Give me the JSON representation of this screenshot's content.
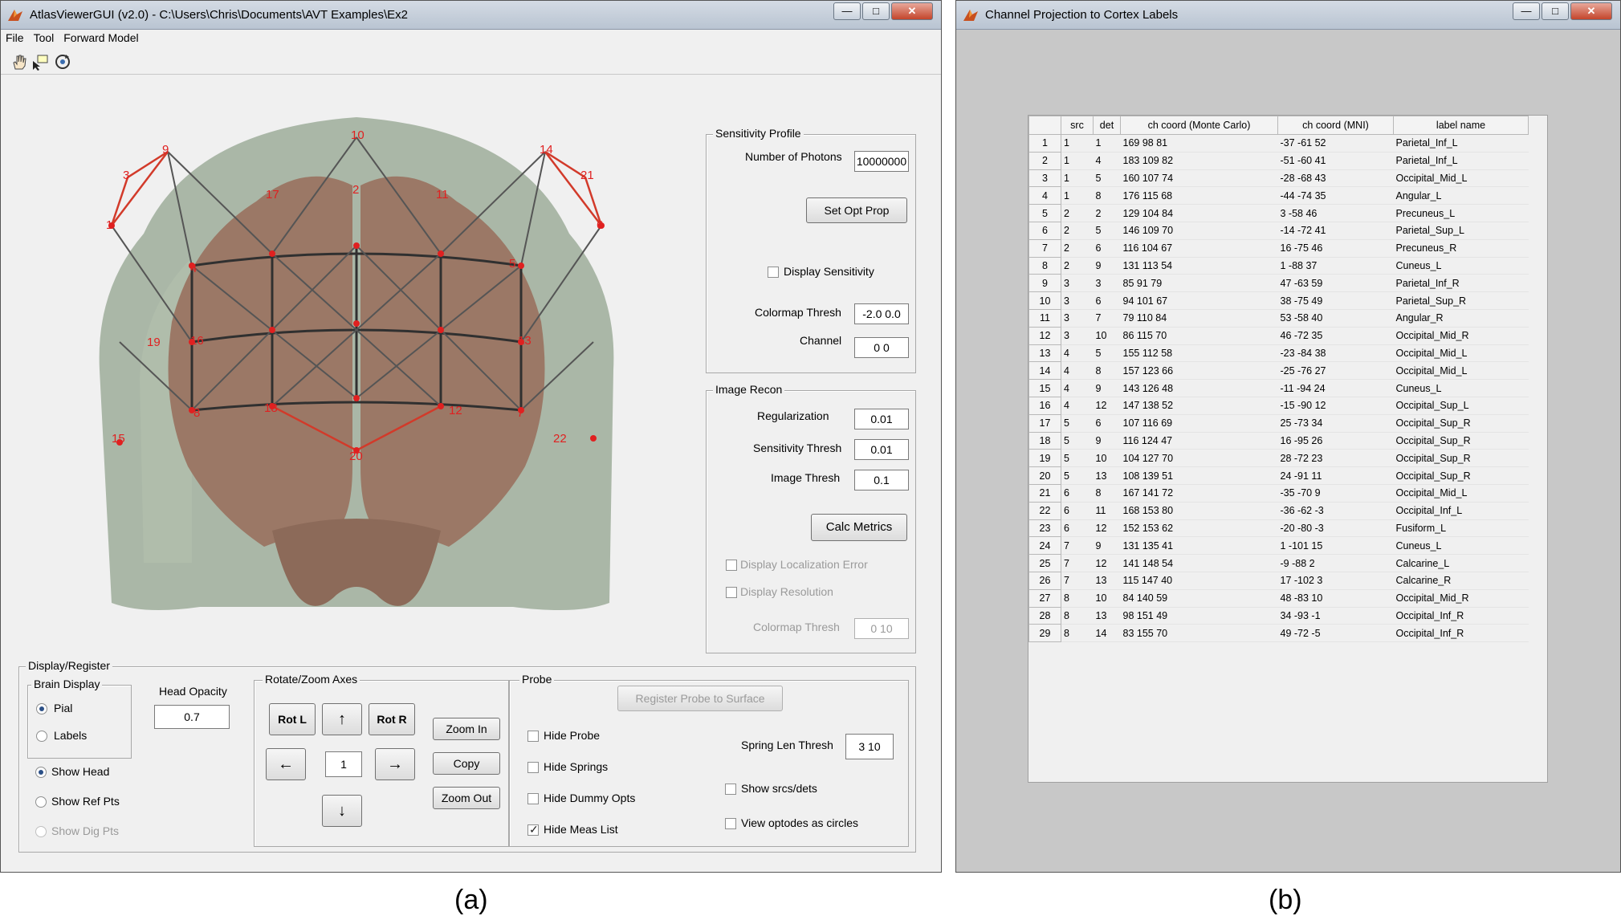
{
  "window_a": {
    "title": "AtlasViewerGUI  (v2.0) - C:\\Users\\Chris\\Documents\\AVT Examples\\Ex2",
    "menu": [
      "File",
      "Tool",
      "Forward Model"
    ],
    "sensitivity_profile": {
      "title": "Sensitivity Profile",
      "num_photons_label": "Number of Photons",
      "num_photons_value": "10000000",
      "set_opt_prop": "Set Opt Prop",
      "display_sensitivity": "Display Sensitivity",
      "colormap_thresh_label": "Colormap Thresh",
      "colormap_thresh_value": "-2.0 0.0",
      "channel_label": "Channel",
      "channel_value": "0 0"
    },
    "image_recon": {
      "title": "Image Recon",
      "regularization_label": "Regularization",
      "regularization_value": "0.01",
      "sens_thresh_label": "Sensitivity Thresh",
      "sens_thresh_value": "0.01",
      "image_thresh_label": "Image Thresh",
      "image_thresh_value": "0.1",
      "calc_metrics": "Calc Metrics",
      "display_loc_error": "Display Localization Error",
      "display_resolution": "Display Resolution",
      "colormap_thresh_label": "Colormap Thresh",
      "colormap_thresh_value": "0 10"
    },
    "display_register": {
      "title": "Display/Register",
      "brain_display": "Brain Display",
      "pial": "Pial",
      "labels": "Labels",
      "head_opacity_label": "Head Opacity",
      "head_opacity_value": "0.7",
      "show_head": "Show Head",
      "show_ref_pts": "Show Ref Pts",
      "show_dig_pts": "Show Dig Pts"
    },
    "rotate_zoom": {
      "title": "Rotate/Zoom Axes",
      "rot_l": "Rot L",
      "up": "↑",
      "rot_r": "Rot R",
      "left": "←",
      "step": "1",
      "right": "→",
      "down": "↓",
      "zoom_in": "Zoom In",
      "copy": "Copy",
      "zoom_out": "Zoom Out"
    },
    "probe": {
      "title": "Probe",
      "register": "Register Probe to Surface",
      "hide_probe": "Hide Probe",
      "hide_springs": "Hide Springs",
      "hide_dummy": "Hide Dummy Opts",
      "hide_meas": "Hide Meas List",
      "spring_len_label": "Spring Len Thresh",
      "spring_len_value": "3  10",
      "show_srcs": "Show srcs/dets",
      "view_circles": "View optodes as circles"
    },
    "optode_labels": [
      "10",
      "9",
      "3",
      "1",
      "14",
      "21",
      "6",
      "17",
      "2",
      "11",
      "19",
      "5",
      "4",
      "15",
      "8",
      "7",
      "18",
      "20",
      "12",
      "16",
      "13",
      "22"
    ]
  },
  "window_b": {
    "title": "Channel Projection to Cortex Labels",
    "columns": [
      "src",
      "det",
      "ch coord (Monte Carlo)",
      "ch coord (MNI)",
      "label name"
    ],
    "rows": [
      [
        "1",
        "1",
        "169  98  81",
        "-37 -61  52",
        "Parietal_Inf_L"
      ],
      [
        "1",
        "4",
        "183  109  82",
        "-51 -60  41",
        "Parietal_Inf_L"
      ],
      [
        "1",
        "5",
        "160  107  74",
        "-28 -68  43",
        "Occipital_Mid_L"
      ],
      [
        "1",
        "8",
        "176  115  68",
        "-44 -74  35",
        "Angular_L"
      ],
      [
        "2",
        "2",
        "129  104  84",
        "3 -58  46",
        "Precuneus_L"
      ],
      [
        "2",
        "5",
        "146  109  70",
        "-14 -72  41",
        "Parietal_Sup_L"
      ],
      [
        "2",
        "6",
        "116  104  67",
        "16 -75  46",
        "Precuneus_R"
      ],
      [
        "2",
        "9",
        "131  113  54",
        "1 -88  37",
        "Cuneus_L"
      ],
      [
        "3",
        "3",
        "85  91  79",
        "47 -63  59",
        "Parietal_Inf_R"
      ],
      [
        "3",
        "6",
        "94  101  67",
        "38 -75  49",
        "Parietal_Sup_R"
      ],
      [
        "3",
        "7",
        "79  110  84",
        "53 -58  40",
        "Angular_R"
      ],
      [
        "3",
        "10",
        "86  115  70",
        "46 -72  35",
        "Occipital_Mid_R"
      ],
      [
        "4",
        "5",
        "155  112  58",
        "-23 -84  38",
        "Occipital_Mid_L"
      ],
      [
        "4",
        "8",
        "157  123  66",
        "-25 -76  27",
        "Occipital_Mid_L"
      ],
      [
        "4",
        "9",
        "143  126  48",
        "-11 -94  24",
        "Cuneus_L"
      ],
      [
        "4",
        "12",
        "147  138  52",
        "-15 -90  12",
        "Occipital_Sup_L"
      ],
      [
        "5",
        "6",
        "107  116  69",
        "25 -73  34",
        "Occipital_Sup_R"
      ],
      [
        "5",
        "9",
        "116  124  47",
        "16 -95  26",
        "Occipital_Sup_R"
      ],
      [
        "5",
        "10",
        "104  127  70",
        "28 -72  23",
        "Occipital_Sup_R"
      ],
      [
        "5",
        "13",
        "108  139  51",
        "24 -91  11",
        "Occipital_Sup_R"
      ],
      [
        "6",
        "8",
        "167  141  72",
        "-35 -70   9",
        "Occipital_Mid_L"
      ],
      [
        "6",
        "11",
        "168  153  80",
        "-36 -62  -3",
        "Occipital_Inf_L"
      ],
      [
        "6",
        "12",
        "152  153  62",
        "-20 -80  -3",
        "Fusiform_L"
      ],
      [
        "7",
        "9",
        "131  135  41",
        "1 -101  15",
        "Cuneus_L"
      ],
      [
        "7",
        "12",
        "141  148  54",
        "-9 -88   2",
        "Calcarine_L"
      ],
      [
        "7",
        "13",
        "115  147  40",
        "17 -102   3",
        "Calcarine_R"
      ],
      [
        "8",
        "10",
        "84  140  59",
        "48 -83  10",
        "Occipital_Mid_R"
      ],
      [
        "8",
        "13",
        "98  151  49",
        "34 -93  -1",
        "Occipital_Inf_R"
      ],
      [
        "8",
        "14",
        "83  155  70",
        "49 -72  -5",
        "Occipital_Inf_R"
      ]
    ]
  },
  "captions": {
    "a": "(a)",
    "b": "(b)"
  },
  "colors": {
    "head": "#8e9d8a",
    "brain": "#9a7563",
    "optode": "#e02020",
    "grid_line": "#303030"
  }
}
